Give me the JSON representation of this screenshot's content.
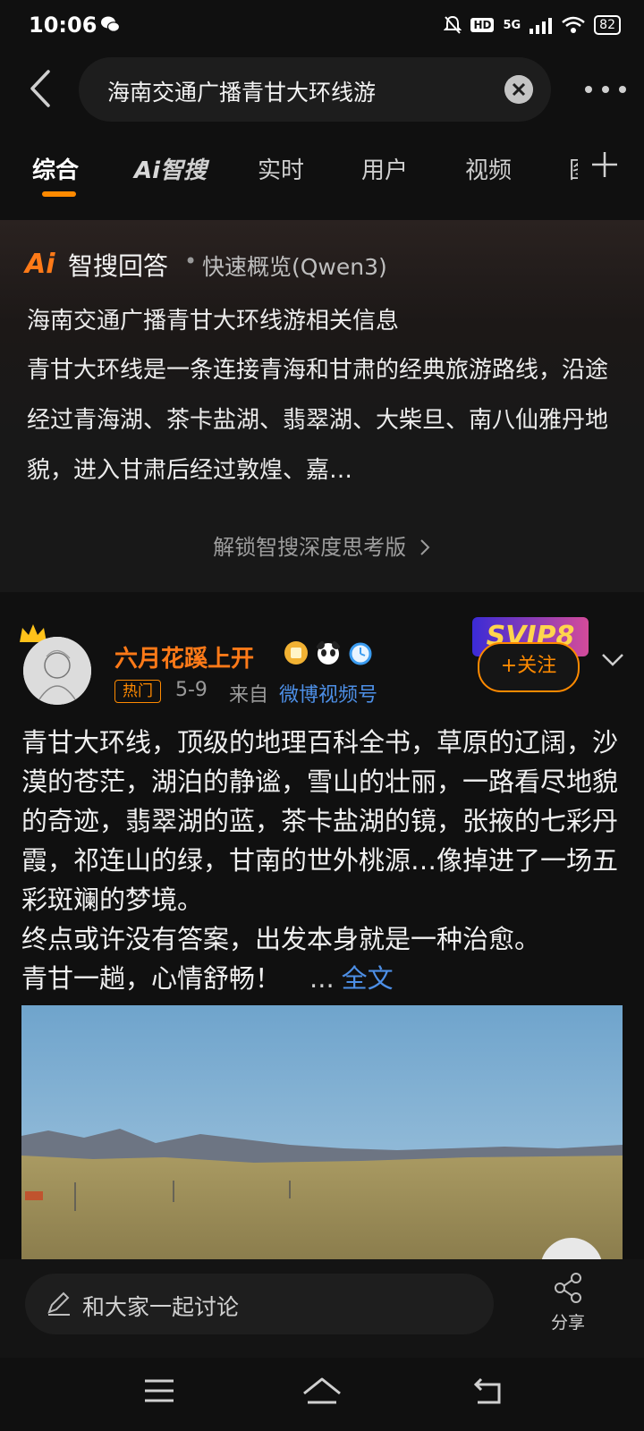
{
  "status_bar": {
    "time": "10:06",
    "hd": "HD",
    "network": "5G",
    "battery": "82"
  },
  "search": {
    "query": "海南交通广播青甘大环线游"
  },
  "tabs": [
    {
      "label": "综合",
      "active": true
    },
    {
      "label": "智搜",
      "prefix": "Ai"
    },
    {
      "label": "实时"
    },
    {
      "label": "用户"
    },
    {
      "label": "视频"
    },
    {
      "label": "图"
    }
  ],
  "ai_card": {
    "logo": "Ai",
    "title": "智搜回答",
    "dot": "•",
    "subtitle": "快速概览(Qwen3)",
    "heading": "海南交通广播青甘大环线游相关信息",
    "body": "青甘大环线是一条连接青海和甘肃的经典旅游路线，沿途经过青海湖、茶卡盐湖、翡翠湖、大柴旦、南八仙雅丹地貌，进入甘肃后经过敦煌、嘉…",
    "unlock": "解锁智搜深度思考版"
  },
  "post": {
    "username": "六月花蹊上开",
    "hot_badge": "热门",
    "date": "5-9",
    "from_label": "来自",
    "source": "微博视频号",
    "vip_label": "SVIP8",
    "follow_label": "+关注",
    "text_lines": [
      "青甘大环线，顶级的地理百科全书，草原的辽阔，沙漠的苍茫，湖泊的静谧，雪山的壮丽，一路看尽地貌的奇迹，翡翠湖的蓝，茶卡盐湖的镜，张掖的七彩丹霞，祁连山的绿，甘南的世外桃源…像掉进了一场五彩斑斓的梦境。",
      "终点或许没有答案，出发本身就是一种治愈。",
      "青甘一趟，心情舒畅！"
    ],
    "ellipsis": "...",
    "full_text": "全文"
  },
  "bottom_bar": {
    "comment_placeholder": "和大家一起讨论",
    "share_label": "分享"
  },
  "colors": {
    "accent": "#ff8a00",
    "link": "#4d8fe6",
    "background": "#101010"
  }
}
